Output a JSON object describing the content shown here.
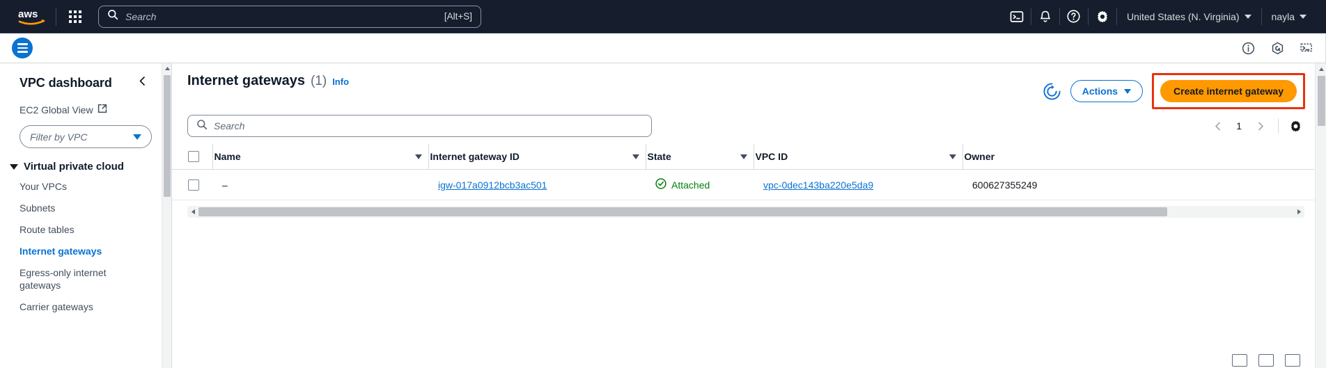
{
  "topnav": {
    "logo_alt": "aws",
    "search_placeholder": "Search",
    "search_value": "",
    "search_shortcut": "[Alt+S]",
    "cloudshell_icon": "cloudshell-icon",
    "notifications_icon": "bell-icon",
    "help_icon": "help-icon",
    "settings_icon": "gear-icon",
    "region": "United States (N. Virginia)",
    "account": "nayla"
  },
  "secondbar": {
    "menu_icon": "hamburger-icon",
    "info_icon": "info-icon",
    "q_icon": "amazon-q-icon",
    "shell_icon": "cloudshell-icon"
  },
  "sidebar": {
    "title": "VPC dashboard",
    "collapse_icon": "chevron-left-icon",
    "ec2_global_view": "EC2 Global View",
    "external_icon": "external-link-icon",
    "filter_placeholder": "Filter by VPC",
    "group_label": "Virtual private cloud",
    "items": [
      {
        "label": "Your VPCs",
        "active": false
      },
      {
        "label": "Subnets",
        "active": false
      },
      {
        "label": "Route tables",
        "active": false
      },
      {
        "label": "Internet gateways",
        "active": true
      },
      {
        "label": "Egress-only internet gateways",
        "active": false
      },
      {
        "label": "Carrier gateways",
        "active": false
      }
    ]
  },
  "main": {
    "title": "Internet gateways",
    "count": "(1)",
    "info_label": "Info",
    "refresh_icon": "refresh-icon",
    "actions_label": "Actions",
    "create_label": "Create internet gateway",
    "search_placeholder": "Search",
    "search_value": "",
    "pagination": {
      "prev_icon": "chevron-left-icon",
      "page": "1",
      "next_icon": "chevron-right-icon",
      "settings_icon": "gear-icon"
    },
    "table": {
      "columns": [
        "Name",
        "Internet gateway ID",
        "State",
        "VPC ID",
        "Owner"
      ],
      "rows": [
        {
          "name": "–",
          "gateway_id": "igw-017a0912bcb3ac501",
          "state": "Attached",
          "state_icon": "check-circle-icon",
          "vpc_id": "vpc-0dec143ba220e5da9",
          "owner": "600627355249"
        }
      ]
    }
  },
  "colors": {
    "nav_bg": "#161e2d",
    "link_blue": "#0972d3",
    "create_orange": "#ff9900",
    "highlight_red": "#e8320e",
    "state_green": "#037f0c"
  }
}
